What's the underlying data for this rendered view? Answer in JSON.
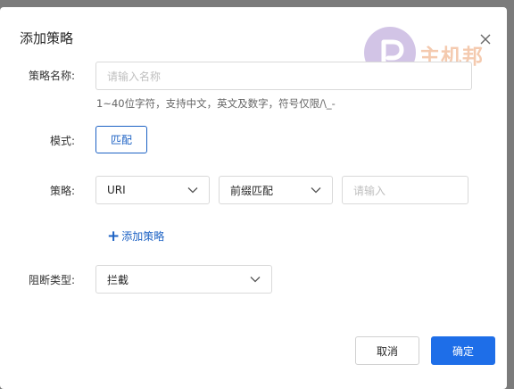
{
  "dialog": {
    "title": "添加策略",
    "watermark_text": "主机邦"
  },
  "form": {
    "name": {
      "label": "策略名称:",
      "placeholder": "请输入名称",
      "hint": "1~40位字符，支持中文，英文及数字，符号仅限/\\_-"
    },
    "mode": {
      "label": "模式:",
      "option": "匹配"
    },
    "policy": {
      "label": "策略:",
      "field_select": "URI",
      "match_select": "前缀匹配",
      "value_placeholder": "请输入",
      "add_label": "添加策略"
    },
    "block_type": {
      "label": "阻断类型:",
      "value": "拦截"
    }
  },
  "footer": {
    "cancel_label": "取消",
    "confirm_label": "确定"
  },
  "colors": {
    "primary": "#1e6ee8",
    "link": "#1d62c4"
  }
}
